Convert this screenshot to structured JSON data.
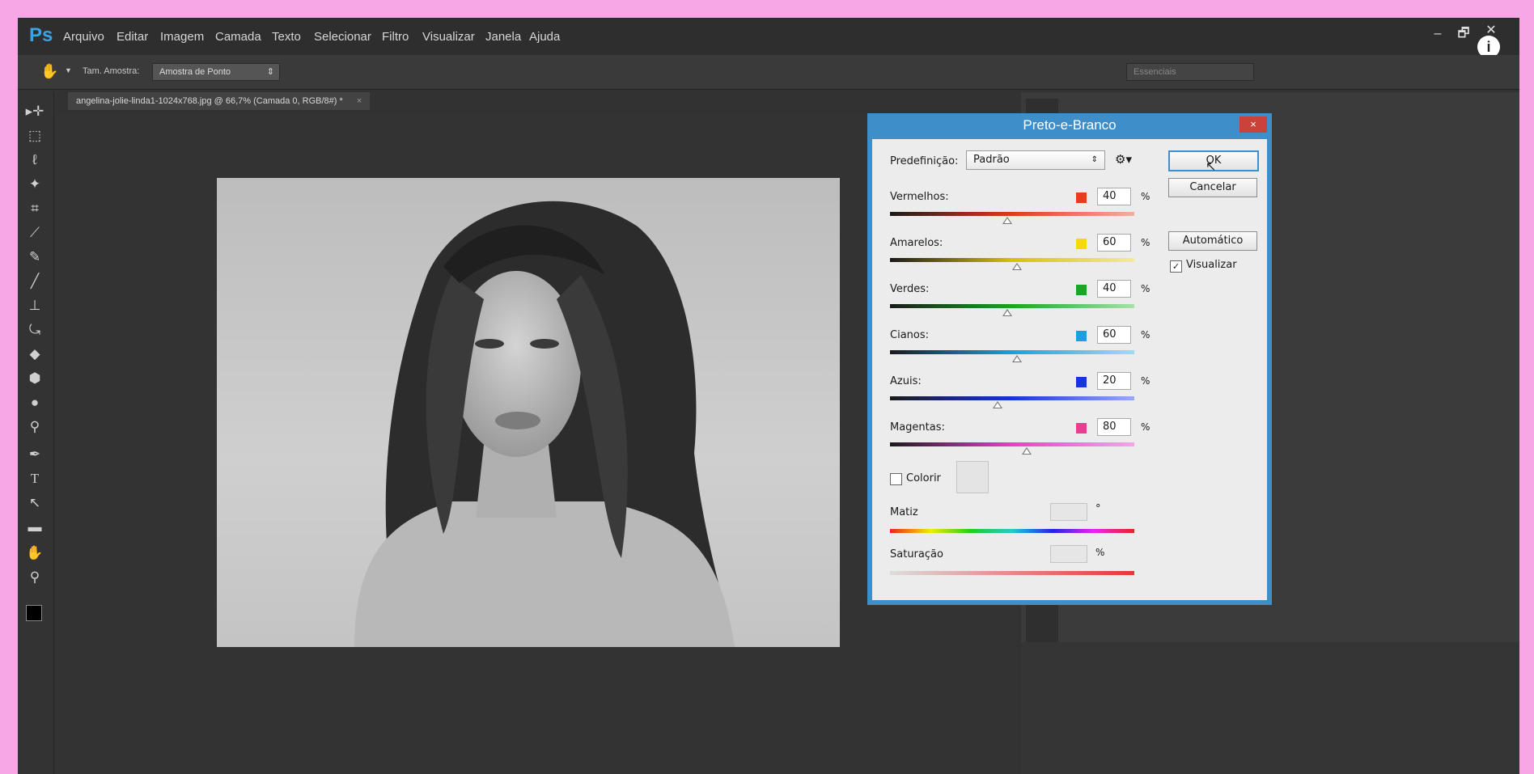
{
  "app": {
    "logo": "Ps",
    "menu": [
      "Arquivo",
      "Editar",
      "Imagem",
      "Camada",
      "Texto",
      "Selecionar",
      "Filtro",
      "Visualizar",
      "Janela",
      "Ajuda"
    ],
    "window_controls": [
      "–",
      "🗗",
      "✕"
    ],
    "info": "i"
  },
  "options_bar": {
    "sample_size_label": "Tam. Amostra:",
    "sample_size_value": "Amostra de Ponto",
    "workspace": "Essenciais"
  },
  "document_tab": {
    "title": "angelina-jolie-linda1-1024x768.jpg @ 66,7% (Camada 0, RGB/8#) *",
    "close": "×"
  },
  "dialog": {
    "title": "Preto-e-Branco",
    "close": "×",
    "preset_label": "Predefinição:",
    "preset_value": "Padrão",
    "buttons": {
      "ok": "OK",
      "cancel": "Cancelar",
      "auto": "Automático"
    },
    "preview_label": "Visualizar",
    "preview_checked": true,
    "channels": [
      {
        "label": "Vermelhos:",
        "value": "40",
        "swatch": "#ea3b1b",
        "gradient": [
          "#1a1a1a",
          "#e33a1a",
          "#f2b0a0"
        ]
      },
      {
        "label": "Amarelos:",
        "value": "60",
        "swatch": "#f5d90a",
        "gradient": [
          "#1a1a1a",
          "#d6c10c",
          "#f3eb9a"
        ]
      },
      {
        "label": "Verdes:",
        "value": "40",
        "swatch": "#1aa523",
        "gradient": [
          "#1a1a1a",
          "#1aa523",
          "#a7e2ab"
        ]
      },
      {
        "label": "Cianos:",
        "value": "60",
        "swatch": "#1c9fe0",
        "gradient": [
          "#1a1a1a",
          "#1c9fe0",
          "#a5d9f4"
        ]
      },
      {
        "label": "Azuis:",
        "value": "20",
        "swatch": "#1634e0",
        "gradient": [
          "#1a1a1a",
          "#1634e0",
          "#9aa9f2"
        ]
      },
      {
        "label": "Magentas:",
        "value": "80",
        "swatch": "#ea3d8f",
        "gradient": [
          "#1a1a1a",
          "#ea3dd0",
          "#f3a6e6"
        ]
      }
    ],
    "percent": "%",
    "colorize_label": "Colorir",
    "hue_label": "Matiz",
    "hue_unit": "°",
    "saturation_label": "Saturação",
    "saturation_unit": "%"
  }
}
